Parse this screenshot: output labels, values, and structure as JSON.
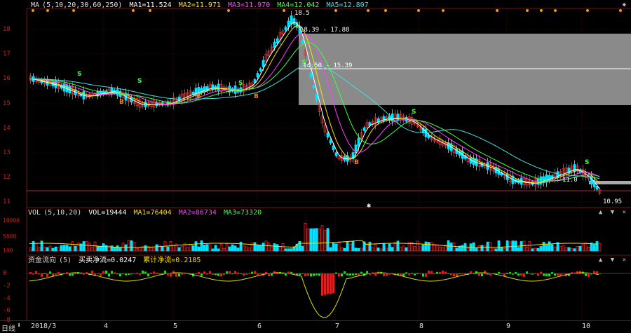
{
  "main_pane": {
    "indicator": "MA",
    "params": "(5,10,20,30,60,250)",
    "ma1": "MA1=11.524",
    "ma2": "MA2=11.971",
    "ma3": "MA3=11.970",
    "ma4": "MA4=12.042",
    "ma5": "MA5=12.807",
    "y_ticks": [
      "18",
      "17",
      "16",
      "15",
      "14",
      "13",
      "12",
      "11"
    ],
    "annotations": {
      "high_label": "18.39 - 17.88",
      "mid_label": "14.50 - 15.39",
      "low_price": "10.95",
      "ma_right": "11.0",
      "peak": "18.5"
    },
    "colors": {
      "up": "#ff2020",
      "down": "#00e0ff",
      "box": "#8a8a8a"
    }
  },
  "vol_pane": {
    "indicator": "VOL",
    "params": "(5,10,20)",
    "vol": "VOL=19444",
    "ma1": "MA1=76404",
    "ma2": "MA2=86734",
    "ma3": "MA3=73320",
    "y_ticks": [
      "10000",
      "5000",
      "100"
    ]
  },
  "fund_pane": {
    "indicator": "资金流向",
    "params": "(5)",
    "main_flow": "买卖净流=0.0247",
    "cum_flow": "累计净流=0.2185",
    "y_ticks": [
      "0",
      "-2",
      "-4",
      "-6",
      "-8"
    ]
  },
  "bottom": {
    "period_label": "日线",
    "x_ticks": [
      "2018/3",
      "4",
      "5",
      "6",
      "7",
      "8",
      "9",
      "10"
    ]
  }
}
